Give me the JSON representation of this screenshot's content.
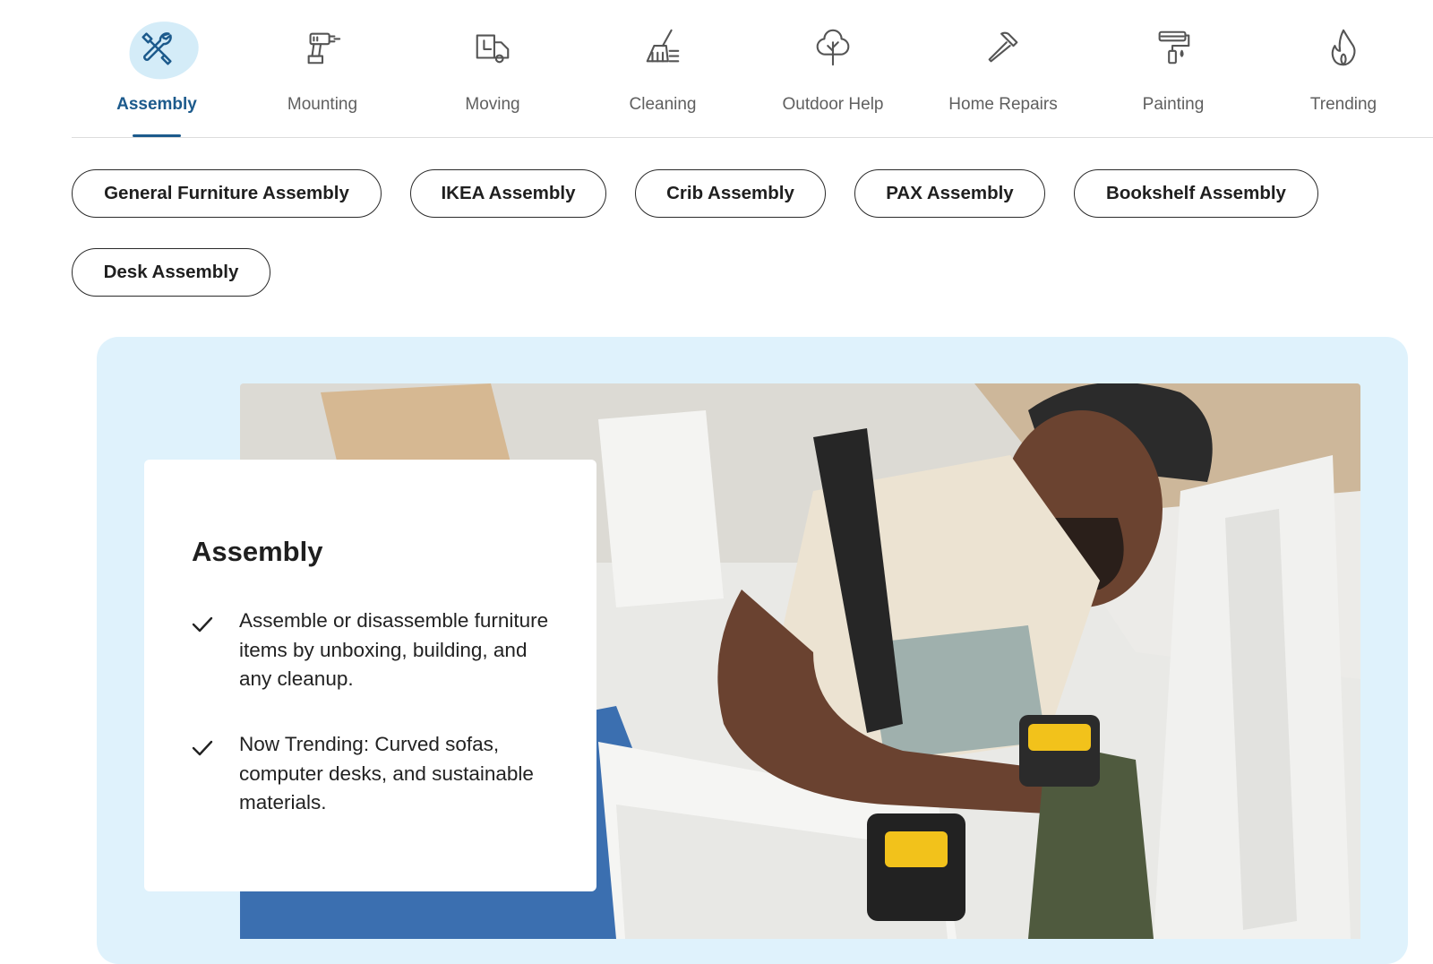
{
  "tabs": [
    {
      "label": "Assembly",
      "icon": "tools-icon",
      "active": true
    },
    {
      "label": "Mounting",
      "icon": "drill-icon",
      "active": false
    },
    {
      "label": "Moving",
      "icon": "moving-truck-icon",
      "active": false
    },
    {
      "label": "Cleaning",
      "icon": "broom-icon",
      "active": false
    },
    {
      "label": "Outdoor Help",
      "icon": "tree-icon",
      "active": false
    },
    {
      "label": "Home Repairs",
      "icon": "hammer-icon",
      "active": false
    },
    {
      "label": "Painting",
      "icon": "paint-roller-icon",
      "active": false
    },
    {
      "label": "Trending",
      "icon": "flame-icon",
      "active": false
    }
  ],
  "chips": [
    "General Furniture Assembly",
    "IKEA Assembly",
    "Crib Assembly",
    "PAX Assembly",
    "Bookshelf Assembly",
    "Desk Assembly"
  ],
  "card": {
    "title": "Assembly",
    "bullets": [
      "Assemble or disassemble furniture items by unboxing, building, and any cleanup.",
      "Now Trending: Curved sofas, computer desks, and sustainable materials."
    ]
  },
  "colors": {
    "accent": "#1c5a8c",
    "panel_bg": "#dff2fc",
    "active_icon_bg": "#d4ecf8"
  }
}
